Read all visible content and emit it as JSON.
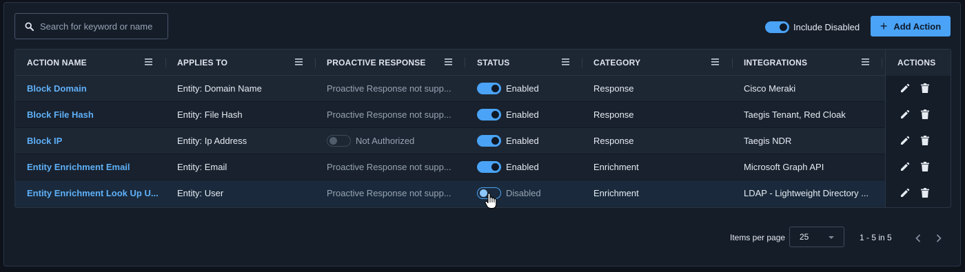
{
  "search": {
    "placeholder": "Search for keyword or name",
    "icon": "search-icon"
  },
  "include_disabled": {
    "label": "Include Disabled",
    "checked": true
  },
  "add_action": {
    "label": "Add Action",
    "icon": "plus-icon"
  },
  "columns": {
    "action_name": "ACTION NAME",
    "applies_to": "APPLIES TO",
    "proactive_response": "PROACTIVE RESPONSE",
    "status": "STATUS",
    "category": "CATEGORY",
    "integrations": "INTEGRATIONS",
    "actions": "ACTIONS"
  },
  "rows": [
    {
      "name": "Block Domain",
      "applies_to": "Entity: Domain Name",
      "proactive": "Proactive Response not supp...",
      "proactive_toggle": false,
      "status": "Enabled",
      "status_on": true,
      "category": "Response",
      "integrations": "Cisco Meraki"
    },
    {
      "name": "Block File Hash",
      "applies_to": "Entity: File Hash",
      "proactive": "Proactive Response not supp...",
      "proactive_toggle": false,
      "status": "Enabled",
      "status_on": true,
      "category": "Response",
      "integrations": "Taegis Tenant, Red Cloak"
    },
    {
      "name": "Block IP",
      "applies_to": "Entity: Ip Address",
      "proactive": "Not Authorized",
      "proactive_toggle": true,
      "status": "Enabled",
      "status_on": true,
      "category": "Response",
      "integrations": "Taegis NDR"
    },
    {
      "name": "Entity Enrichment Email",
      "applies_to": "Entity: Email",
      "proactive": "Proactive Response not supp...",
      "proactive_toggle": false,
      "status": "Enabled",
      "status_on": true,
      "category": "Enrichment",
      "integrations": "Microsoft Graph API"
    },
    {
      "name": "Entity Enrichment Look Up U...",
      "applies_to": "Entity: User",
      "proactive": "Proactive Response not supp...",
      "proactive_toggle": false,
      "status": "Disabled",
      "status_on": false,
      "category": "Enrichment",
      "integrations": "LDAP - Lightweight Directory ..."
    }
  ],
  "pagination": {
    "items_per_page_label": "Items per page",
    "items_per_page": "25",
    "range": "1 - 5 in 5"
  },
  "colors": {
    "accent": "#4aa3f7",
    "link": "#5fb0f8",
    "background": "#151d29"
  }
}
